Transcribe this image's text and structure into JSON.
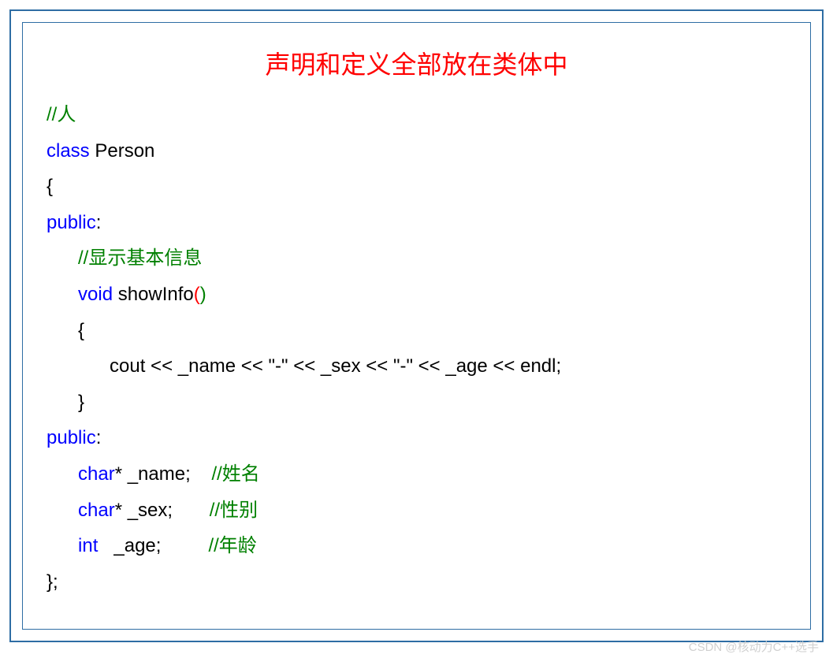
{
  "title": "声明和定义全部放在类体中",
  "code": {
    "comment_person": "//人",
    "kw_class": "class",
    "class_name": " Person",
    "brace_open": "{",
    "kw_public1": "public",
    "colon1": ":",
    "comment_showinfo": "//显示基本信息",
    "kw_void": "void",
    "fn_name": " showInfo",
    "paren_open": "(",
    "paren_close": ")",
    "fn_brace_open": "{",
    "cout_line": "cout << _name << \"-\" << _sex << \"-\" << _age << endl;",
    "fn_brace_close": "}",
    "kw_public2": "public",
    "colon2": ":",
    "kw_char1": "char",
    "star_name": "* _name;",
    "comment_name": "//姓名",
    "kw_char2": "char",
    "star_sex": "* _sex;",
    "comment_sex": "//性别",
    "kw_int": "int",
    "age_decl": "   _age;",
    "comment_age": "//年龄",
    "brace_close": "};"
  },
  "watermark": "CSDN @核动力C++选手"
}
